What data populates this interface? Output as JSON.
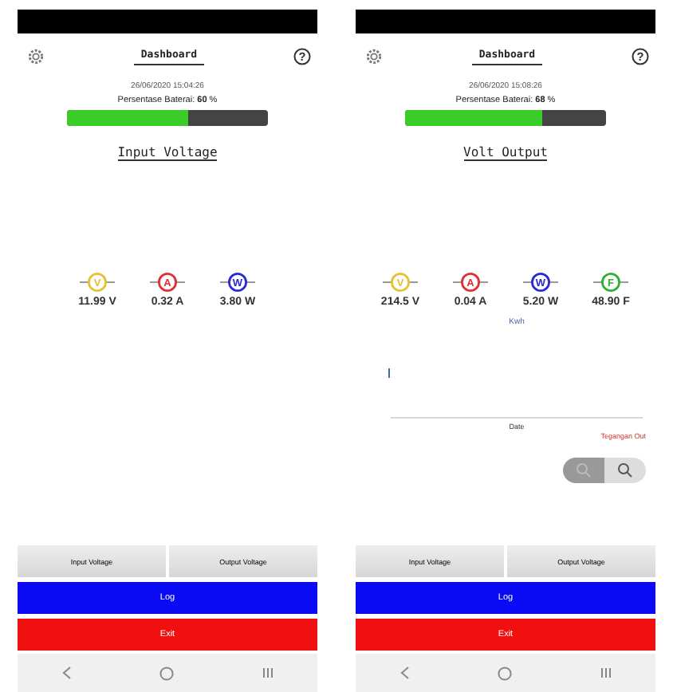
{
  "screens": [
    {
      "title": "Dashboard",
      "help_symbol": "?",
      "timestamp": "26/06/2020 15:04:26",
      "battery": {
        "text": "Persentase Baterai: **60** %",
        "level": 0.6
      },
      "section_title": "Input Voltage",
      "meters": [
        {
          "symbol": "V",
          "color": "#e8c030",
          "reading": "11.99 V"
        },
        {
          "symbol": "A",
          "color": "#e03030",
          "reading": "0.32 A"
        },
        {
          "symbol": "W",
          "color": "#2a2ad0",
          "reading": "3.80 W"
        }
      ],
      "tabs": [
        "Input Voltage",
        "Output Voltage"
      ],
      "buttons": [
        {
          "label": "Log",
          "kind": "primary"
        },
        {
          "label": "Exit",
          "kind": "danger"
        }
      ]
    },
    {
      "title": "Dashboard",
      "help_symbol": "?",
      "timestamp": "26/06/2020 15:08:26",
      "battery": {
        "text": "Persentase Baterai: **68** %",
        "level": 0.68
      },
      "section_title": "Volt Output",
      "meters": [
        {
          "symbol": "V",
          "color": "#e8c030",
          "reading": "214.5 V"
        },
        {
          "symbol": "A",
          "color": "#e03030",
          "reading": "0.04 A"
        },
        {
          "symbol": "W",
          "color": "#2a2ad0",
          "reading": "5.20 W"
        },
        {
          "symbol": "F",
          "color": "#30b030",
          "reading": "48.90 F"
        }
      ],
      "chart": {
        "ylabel": "Kwh",
        "xlabel": "Date",
        "legend": "Tegangan Out"
      },
      "zoom_controls": true,
      "tabs": [
        "Input Voltage",
        "Output Voltage"
      ],
      "buttons": [
        {
          "label": "Log",
          "kind": "primary"
        },
        {
          "label": "Exit",
          "kind": "danger"
        }
      ]
    }
  ]
}
